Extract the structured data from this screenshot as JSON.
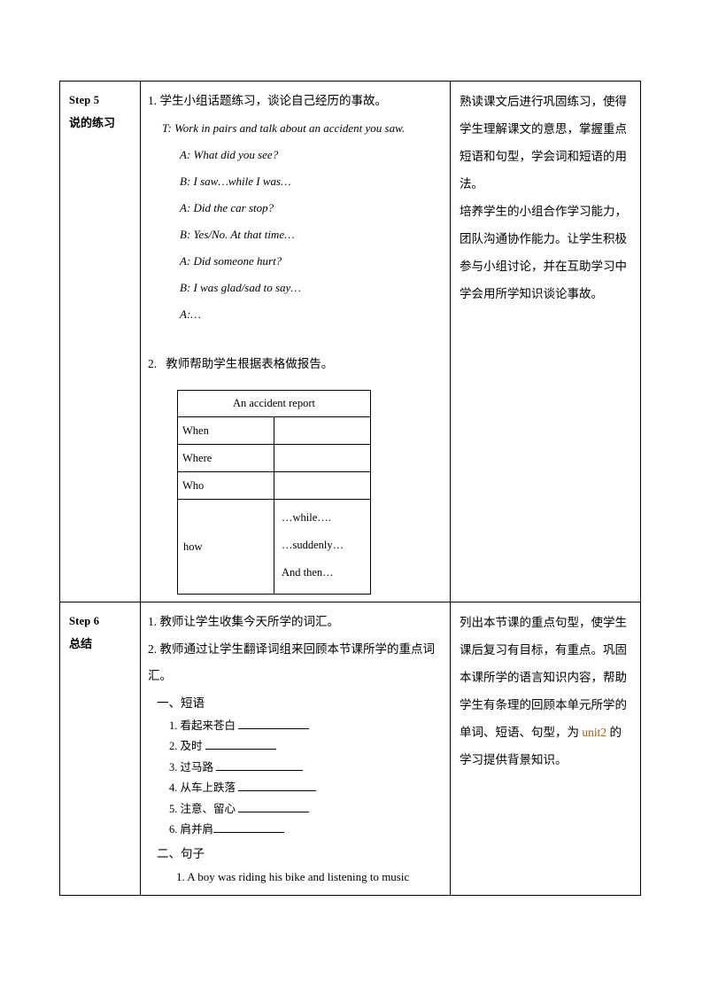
{
  "document": {
    "type": "lesson-plan-table",
    "page_background": "#ffffff",
    "accent_color": "#9b5d20"
  },
  "table": {
    "columns": [
      "step",
      "activity",
      "design_intent"
    ],
    "rows": [
      {
        "step": {
          "label_en": "Step 5",
          "label_cn": "说的练习"
        },
        "activity": {
          "item1_number": "1.",
          "item1_text": "学生小组话题练习，谈论自己经历的事故。",
          "dialogue": [
            {
              "speaker_line": "T: Work in pairs and talk about an accident you saw.",
              "indent": "t"
            },
            {
              "speaker_line": "A: What did you see?",
              "indent": "ab"
            },
            {
              "speaker_line": "B: I saw…while I was…",
              "indent": "ab"
            },
            {
              "speaker_line": "A: Did the car stop?",
              "indent": "ab"
            },
            {
              "speaker_line": "B: Yes/No. At that time…",
              "indent": "ab"
            },
            {
              "speaker_line": "A: Did someone hurt?",
              "indent": "ab"
            },
            {
              "speaker_line": "B: I was glad/sad to say…",
              "indent": "ab"
            },
            {
              "speaker_line": "A:…",
              "indent": "ab"
            }
          ],
          "item2_number": "2.",
          "item2_text": "教师帮助学生根据表格做报告。",
          "report_table": {
            "title": "An accident report",
            "rows": [
              {
                "key": "When",
                "value": ""
              },
              {
                "key": "Where",
                "value": ""
              },
              {
                "key": "Who",
                "value": ""
              }
            ],
            "how_label": "how",
            "how_items": [
              "…while….",
              "…suddenly…",
              "And then…"
            ]
          }
        },
        "design_intent": {
          "paragraphs": [
            "熟读课文后进行巩固练习，使得学生理解课文的意思，掌握重点短语和句型，学会词和短语的用法。",
            "培养学生的小组合作学习能力，团队沟通协作能力。让学生积极参与小组讨论，并在互助学习中学会用所学知识谈论事故。"
          ]
        }
      },
      {
        "step": {
          "label_en": "Step 6",
          "label_cn": "总结"
        },
        "activity": {
          "item1_number": "1.",
          "item1_text": "教师让学生收集今天所学的词汇。",
          "item2_number": "2.",
          "item2_text": "教师通过让学生翻译词组来回顾本节课所学的重点词汇。",
          "section1_heading": "一、短语",
          "phrases": [
            {
              "number": "1.",
              "text": "看起来苍白",
              "blank_width": 80
            },
            {
              "number": "2.",
              "text": "及时",
              "blank_width": 80
            },
            {
              "number": "3.",
              "text": "过马路",
              "blank_width": 98
            },
            {
              "number": "4.",
              "text": "从车上跌落",
              "blank_width": 88
            },
            {
              "number": "5.",
              "text": "注意、留心",
              "blank_width": 80
            },
            {
              "number": "6.",
              "text": "肩并肩",
              "blank_width": 80
            }
          ],
          "section2_heading": "二、句子",
          "sentences": [
            {
              "number": "1.",
              "text": "A boy was riding his bike and listening to music"
            }
          ]
        },
        "design_intent": {
          "text_before_accent": "列出本节课的重点句型，使学生课后复习有目标，有重点。巩固本课所学的语言知识内容，帮助学生有条理的回顾本单元所学的单词、短语、句型，为 ",
          "accent_word": "unit2",
          "text_after_accent": " 的学习提供背景知识。"
        }
      }
    ]
  }
}
